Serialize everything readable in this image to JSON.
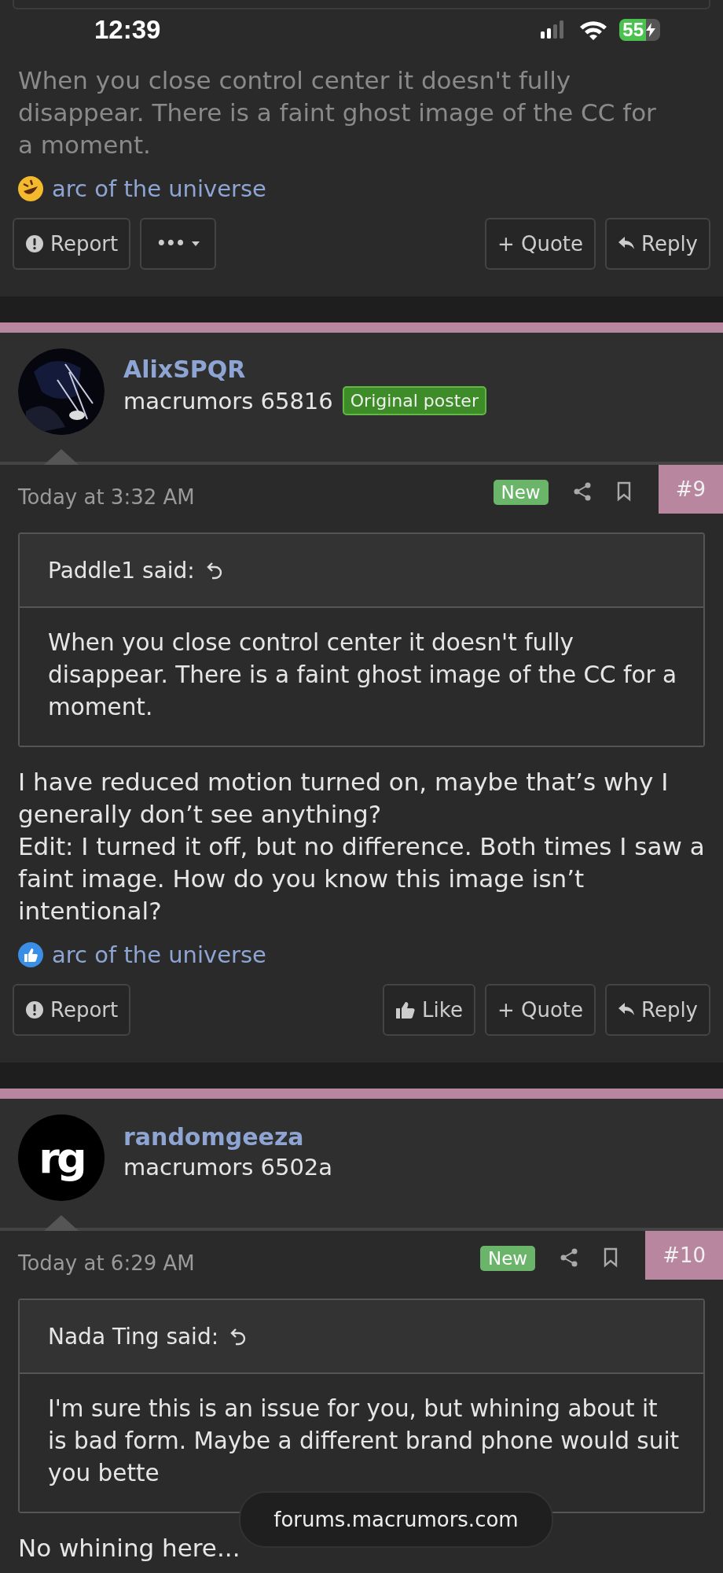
{
  "status_bar": {
    "time": "12:39",
    "battery": "55",
    "charging": true
  },
  "posts": [
    {
      "body": "When you close control center it doesn't fully disappear. There is a faint ghost image of the CC for a moment.",
      "reaction": {
        "kind": "laugh",
        "names": "arc of the universe"
      },
      "actions": [
        {
          "kind": "report",
          "label": "Report"
        },
        {
          "kind": "more",
          "label": "•••"
        },
        {
          "kind": "quote",
          "label": "+ Quote"
        },
        {
          "kind": "reply",
          "label": "Reply"
        }
      ]
    },
    {
      "author": {
        "name": "AlixSPQR",
        "title": "macrumors 65816",
        "badge": "Original poster"
      },
      "date": "Today at 3:32 AM",
      "new": "New",
      "number": "#9",
      "quote": {
        "author": "Paddle1 said:",
        "text": "When you close control center it doesn't fully disappear. There is a faint ghost image of the CC for a moment."
      },
      "body": "I have reduced motion turned on, maybe that’s why I generally don’t see anything?\nEdit: I turned it off, but no difference. Both times I saw a faint image. How do you know this image isn’t intentional?",
      "reaction": {
        "kind": "like",
        "names": "arc of the universe"
      },
      "actions": [
        {
          "kind": "report",
          "label": "Report"
        },
        {
          "kind": "like",
          "label": "Like"
        },
        {
          "kind": "quote",
          "label": "+ Quote"
        },
        {
          "kind": "reply",
          "label": "Reply"
        }
      ]
    },
    {
      "author": {
        "name": "randomgeeza",
        "title": "macrumors 6502a",
        "initials": "rg"
      },
      "date": "Today at 6:29 AM",
      "new": "New",
      "number": "#10",
      "quote": {
        "author": "Nada Ting said:",
        "text": "I'm sure this is an issue for you, but whining about it is bad form. Maybe a different brand phone would suit you bette"
      },
      "body": "No whining here..."
    }
  ],
  "url_pill": "forums.macrumors.com"
}
